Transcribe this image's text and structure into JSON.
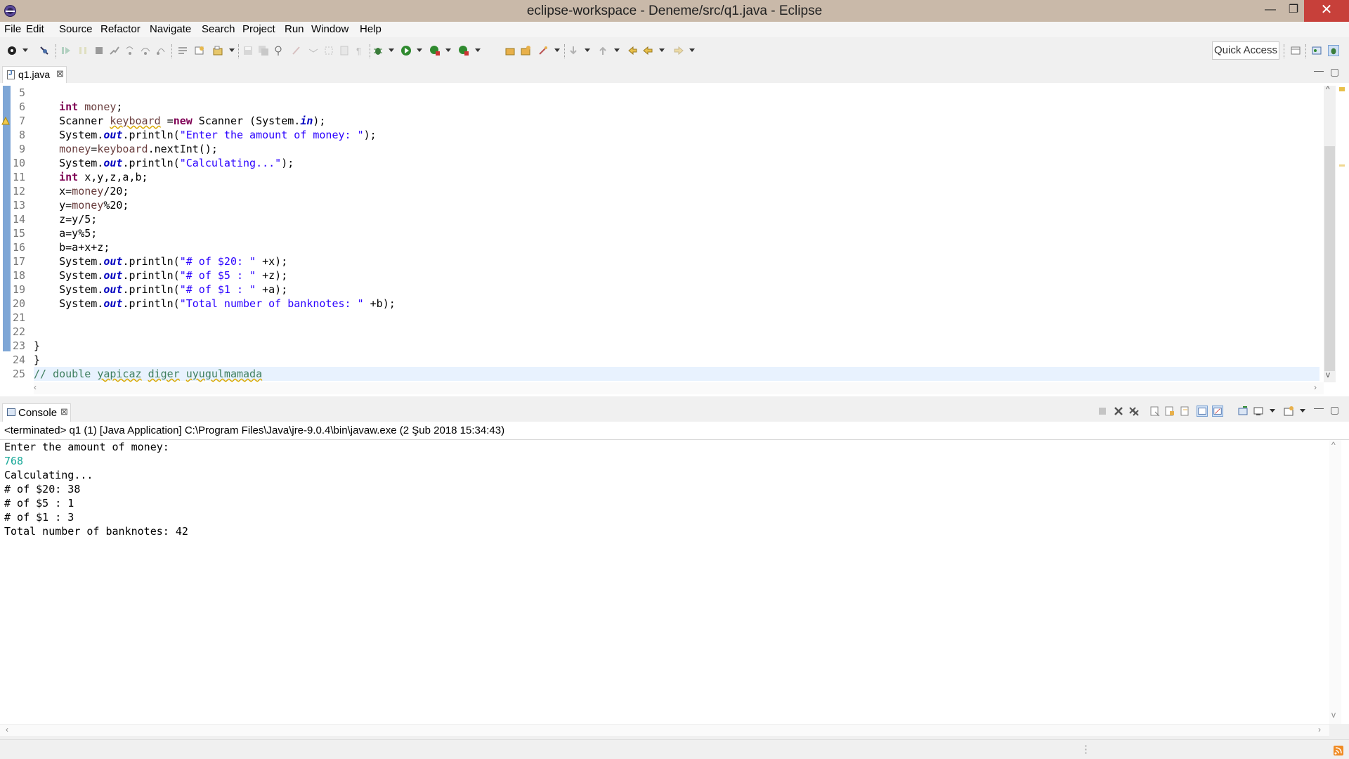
{
  "window": {
    "title": "eclipse-workspace - Deneme/src/q1.java - Eclipse"
  },
  "menu": [
    "File",
    "Edit",
    "Source",
    "Refactor",
    "Navigate",
    "Search",
    "Project",
    "Run",
    "Window",
    "Help"
  ],
  "toolbar": {
    "quick_access": "Quick Access"
  },
  "editor": {
    "tab_label": "q1.java",
    "tab_close": "⊠",
    "line_numbers": [
      "5",
      "6",
      "7",
      "8",
      "9",
      "10",
      "11",
      "12",
      "13",
      "14",
      "15",
      "16",
      "17",
      "18",
      "19",
      "20",
      "21",
      "22",
      "23",
      "24",
      "25"
    ],
    "code": [
      "",
      "    int money;",
      "    Scanner keyboard =new Scanner (System.in);",
      "    System.out.println(\"Enter the amount of money: \");",
      "    money=keyboard.nextInt();",
      "    System.out.println(\"Calculating...\");",
      "    int x,y,z,a,b;",
      "    x=money/20;",
      "    y=money%20;",
      "    z=y/5;",
      "    a=y%5;",
      "    b=a+x+z;",
      "    System.out.println(\"# of $20: \" +x);",
      "    System.out.println(\"# of $5 : \" +z);",
      "    System.out.println(\"# of $1 : \" +a);",
      "    System.out.println(\"Total number of banknotes: \" +b);",
      "",
      "",
      "}",
      "}",
      "// double yapicaz diger uyugulmamada"
    ]
  },
  "console": {
    "tab_label": "Console",
    "tab_close": "⊠",
    "status": "<terminated> q1 (1) [Java Application] C:\\Program Files\\Java\\jre-9.0.4\\bin\\javaw.exe (2 Şub 2018 15:34:43)",
    "output": [
      {
        "text": "Enter the amount of money: ",
        "input": false
      },
      {
        "text": "768",
        "input": true
      },
      {
        "text": "Calculating...",
        "input": false
      },
      {
        "text": "# of $20: 38",
        "input": false
      },
      {
        "text": "# of $5 : 1",
        "input": false
      },
      {
        "text": "# of $1 : 3",
        "input": false
      },
      {
        "text": "Total number of banknotes: 42",
        "input": false
      }
    ]
  },
  "colors": {
    "title_bar": "#c9b9a9",
    "close_button": "#c7403a",
    "keyword": "#7f0055",
    "string": "#2a00ff",
    "comment": "#3f7f5f",
    "console_input": "#1aa999"
  }
}
